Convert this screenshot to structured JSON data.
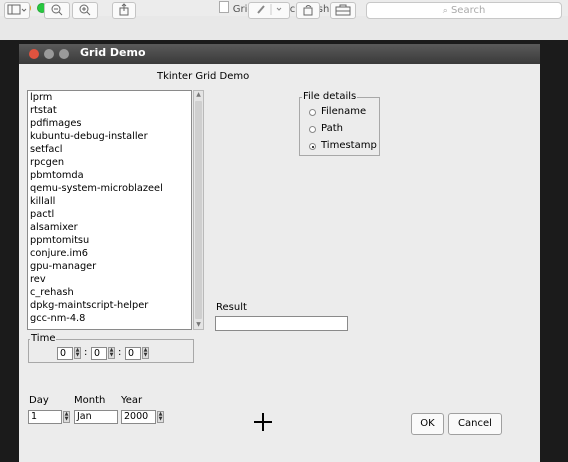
{
  "preview": {
    "title": "GridDemoScreenshot",
    "title_arrow": "⌄",
    "search_placeholder": "Search",
    "toolbar_icons": [
      "sidebar-icon",
      "zoom-out-icon",
      "zoom-in-icon",
      "share-icon",
      "pen-icon",
      "rotate-icon",
      "toolbox-icon"
    ]
  },
  "window": {
    "title": "Grid Demo"
  },
  "heading": "Tkinter Grid Demo",
  "listbox": {
    "items": [
      "lprm",
      "rtstat",
      "pdfimages",
      "kubuntu-debug-installer",
      "setfacl",
      "rpcgen",
      "pbmtomda",
      "qemu-system-microblazeel",
      "killall",
      "pactl",
      "alsamixer",
      "ppmtomitsu",
      "conjure.im6",
      "gpu-manager",
      "rev",
      "c_rehash",
      "dpkg-maintscript-helper",
      "gcc-nm-4.8"
    ]
  },
  "file_details": {
    "title": "File details",
    "options": [
      "Filename",
      "Path",
      "Timestamp"
    ],
    "selected": "Timestamp"
  },
  "result": {
    "label": "Result",
    "value": ""
  },
  "time": {
    "label": "Time",
    "hours": "0",
    "minutes": "0",
    "seconds": "0",
    "separator": ":"
  },
  "date": {
    "day_label": "Day",
    "month_label": "Month",
    "year_label": "Year",
    "day": "1",
    "month": "Jan",
    "year": "2000"
  },
  "buttons": {
    "ok": "OK",
    "cancel": "Cancel"
  },
  "colors": {
    "close": "#fe5f57",
    "minimize": "#febc2e",
    "zoom": "#28c840",
    "dark_bg": "#1b1b1b"
  }
}
